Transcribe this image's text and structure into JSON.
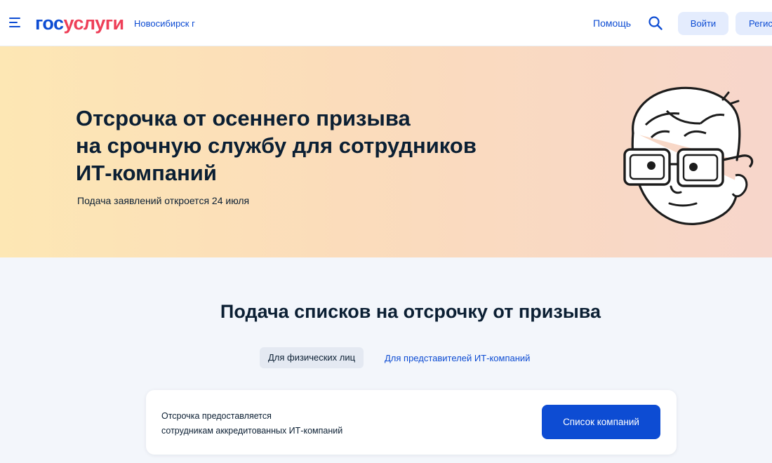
{
  "header": {
    "logo_part1": "гос",
    "logo_part2": "услуги",
    "city": "Новосибирск г",
    "help": "Помощь",
    "login": "Войти",
    "register": "Регистрация"
  },
  "banner": {
    "title_line1": "Отсрочка от осеннего призыва",
    "title_line2": "на срочную службу для сотрудников",
    "title_line3": "ИТ-компаний",
    "subtitle": "Подача заявлений откроется 24 июля"
  },
  "main": {
    "title": "Подача списков на отсрочку от призыва",
    "tabs": [
      {
        "label": "Для физических лиц",
        "active": true
      },
      {
        "label": "Для представителей ИТ-компаний",
        "active": false
      }
    ],
    "card": {
      "text_line1": "Отсрочка предоставляется",
      "text_line2": "сотрудникам аккредитованных ИТ-компаний",
      "button": "Список компаний"
    }
  },
  "icons": {
    "menu": "burger-menu-icon",
    "search": "search-icon",
    "illustration": "person-with-glasses-illustration"
  },
  "colors": {
    "brand_blue": "#0d4cd3",
    "brand_red": "#ee3f58",
    "button_light": "#e4ecfd",
    "page_bg": "#f3f6fb"
  }
}
